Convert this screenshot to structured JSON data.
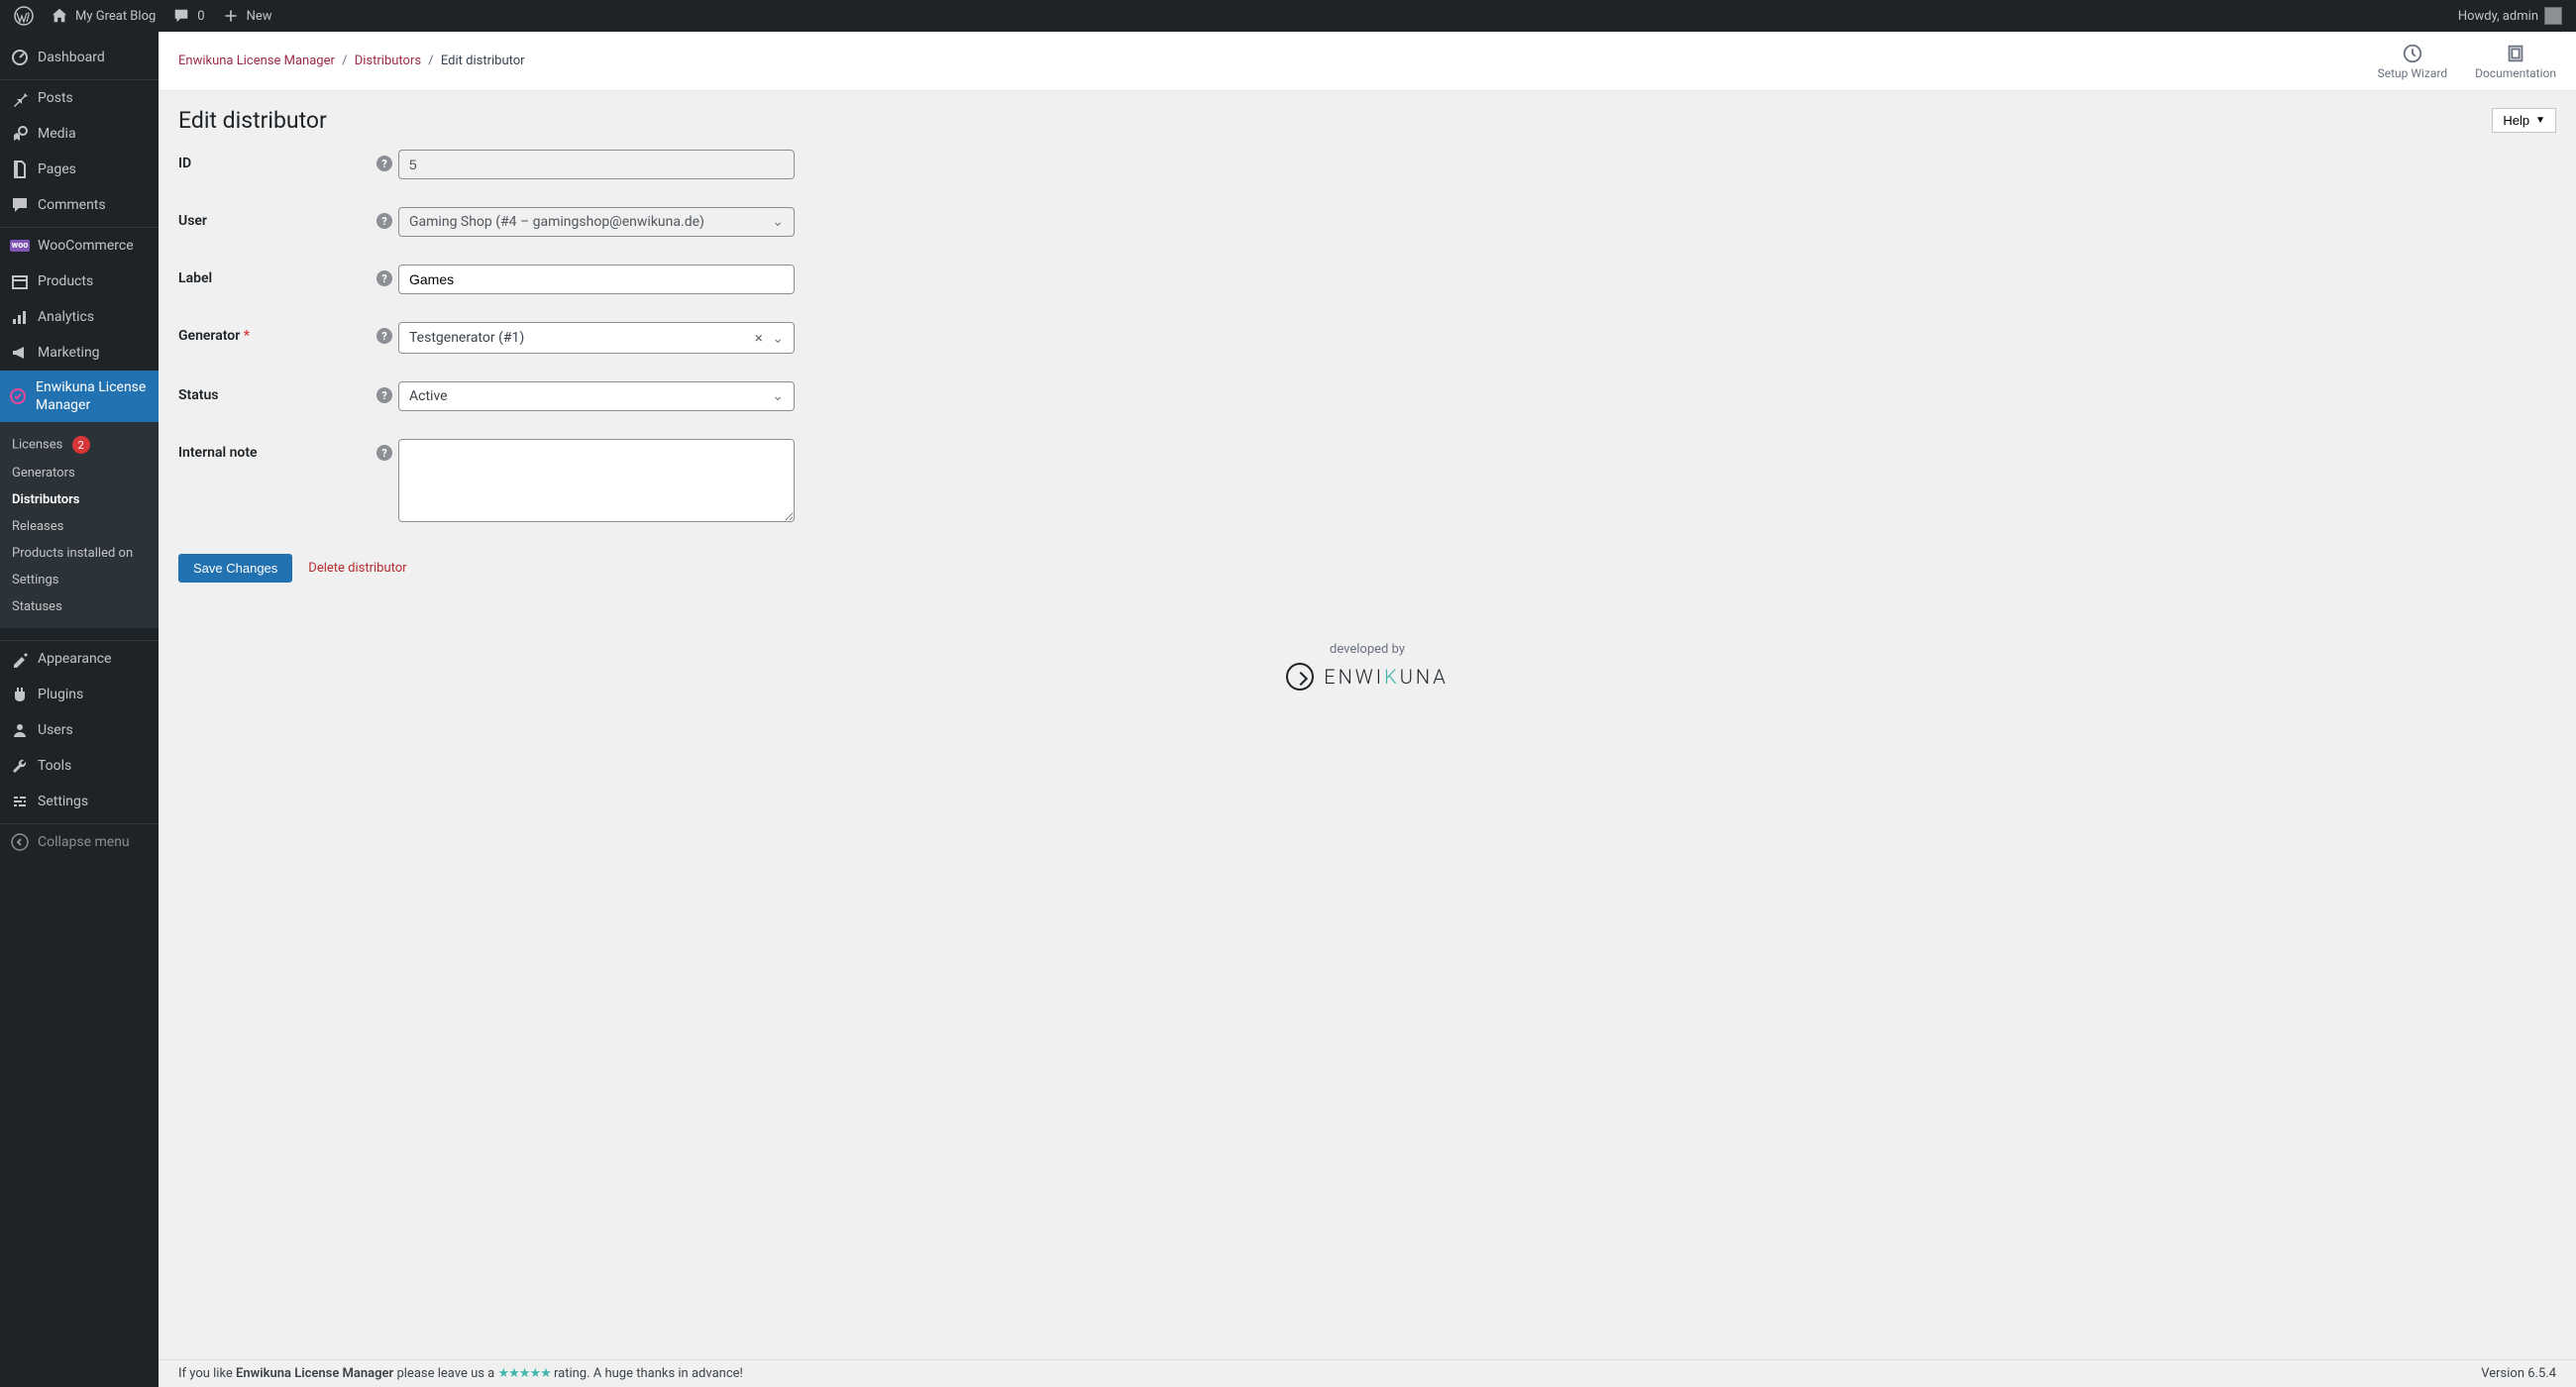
{
  "adminbar": {
    "site_name": "My Great Blog",
    "comments_count": "0",
    "new_label": "New",
    "howdy": "Howdy, admin"
  },
  "sidebar": {
    "items": [
      {
        "icon": "dashboard",
        "label": "Dashboard"
      },
      {
        "icon": "posts",
        "label": "Posts"
      },
      {
        "icon": "media",
        "label": "Media"
      },
      {
        "icon": "pages",
        "label": "Pages"
      },
      {
        "icon": "comments",
        "label": "Comments"
      },
      {
        "icon": "woo",
        "label": "WooCommerce"
      },
      {
        "icon": "products",
        "label": "Products"
      },
      {
        "icon": "analytics",
        "label": "Analytics"
      },
      {
        "icon": "marketing",
        "label": "Marketing"
      },
      {
        "icon": "elm",
        "label": "Enwikuna License Manager",
        "current": true
      },
      {
        "icon": "appearance",
        "label": "Appearance"
      },
      {
        "icon": "plugins",
        "label": "Plugins"
      },
      {
        "icon": "users",
        "label": "Users"
      },
      {
        "icon": "tools",
        "label": "Tools"
      },
      {
        "icon": "settings",
        "label": "Settings"
      },
      {
        "icon": "collapse",
        "label": "Collapse menu"
      }
    ],
    "submenu": [
      {
        "label": "Licenses",
        "badge": "2"
      },
      {
        "label": "Generators"
      },
      {
        "label": "Distributors",
        "active": true
      },
      {
        "label": "Releases"
      },
      {
        "label": "Products installed on"
      },
      {
        "label": "Settings"
      },
      {
        "label": "Statuses"
      }
    ]
  },
  "topbar": {
    "breadcrumb": {
      "root": "Enwikuna License Manager",
      "parent": "Distributors",
      "current": "Edit distributor"
    },
    "actions": {
      "wizard": "Setup Wizard",
      "docs": "Documentation"
    }
  },
  "page": {
    "title": "Edit distributor",
    "help_label": "Help"
  },
  "form": {
    "id": {
      "label": "ID",
      "value": "5"
    },
    "user": {
      "label": "User",
      "value": "Gaming Shop (#4 – gamingshop@enwikuna.de)"
    },
    "label_field": {
      "label": "Label",
      "value": "Games"
    },
    "generator": {
      "label": "Generator",
      "value": "Testgenerator (#1)"
    },
    "status": {
      "label": "Status",
      "value": "Active"
    },
    "note": {
      "label": "Internal note",
      "value": ""
    },
    "save_btn": "Save Changes",
    "delete_link": "Delete distributor"
  },
  "footer": {
    "developed_by": "developed by",
    "brand_pre": "ENWI",
    "brand_k": "K",
    "brand_post": "UNA",
    "rating_pre": "If you like ",
    "rating_brand": "Enwikuna License Manager",
    "rating_mid": " please leave us a ",
    "rating_post": " rating. A huge thanks in advance!",
    "version": "Version 6.5.4"
  },
  "icons": {
    "wp": "ⓦ",
    "home": "⌂",
    "comments": "💬",
    "plus": "＋",
    "dashboard": "⊙",
    "posts": "📌",
    "media": "🗃",
    "pages": "▯",
    "woo": "woo",
    "products": "▦",
    "analytics": "◫",
    "marketing": "📣",
    "elm": "✓",
    "appearance": "🖌",
    "plugins": "🔌",
    "users": "👤",
    "tools": "🔧",
    "settings": "⛶",
    "collapse": "◀"
  }
}
